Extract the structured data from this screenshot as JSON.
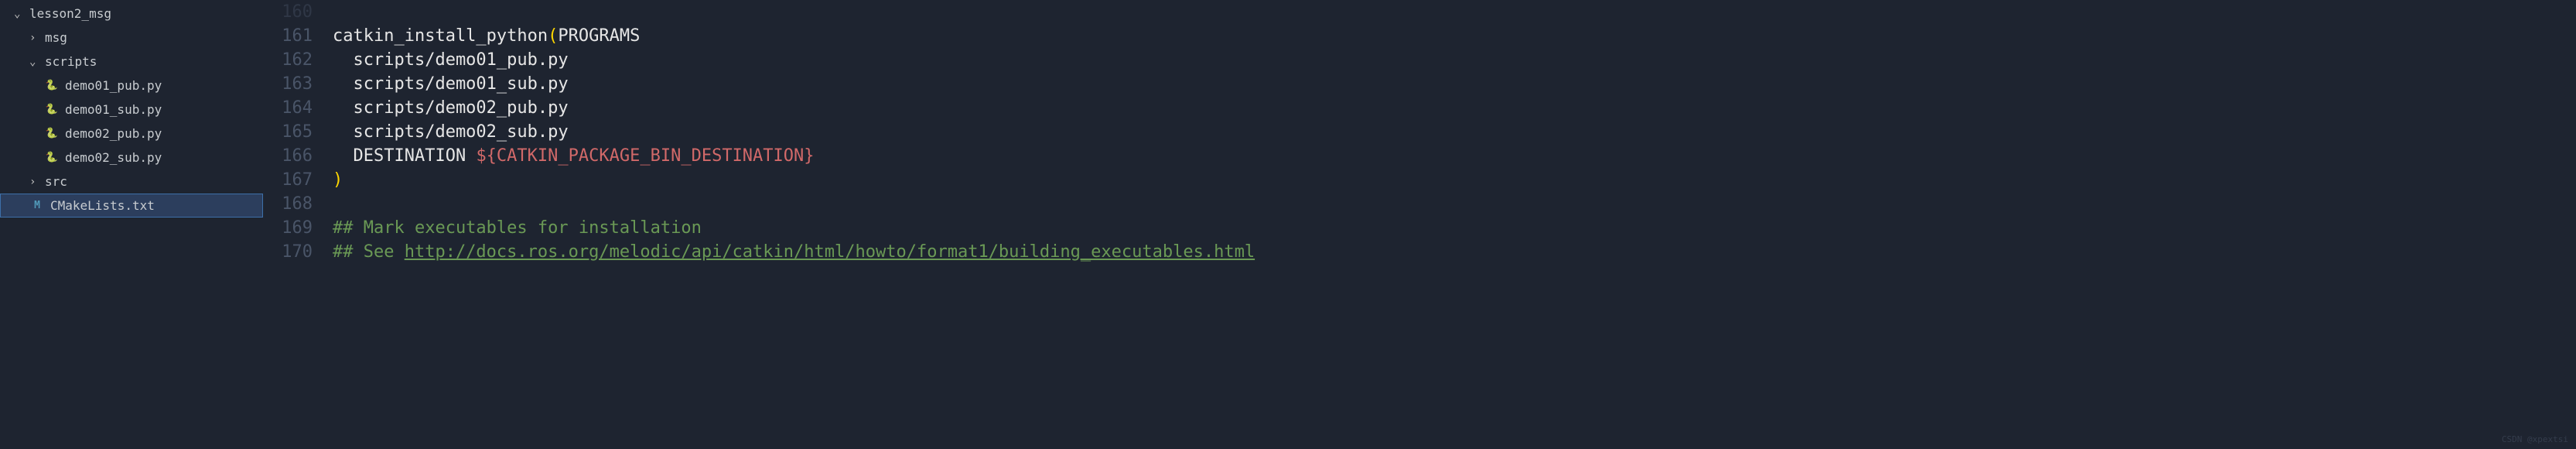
{
  "sidebar": {
    "root": "lesson2_msg",
    "items": [
      {
        "label": "msg",
        "type": "folder",
        "expanded": false,
        "indent": 1
      },
      {
        "label": "scripts",
        "type": "folder",
        "expanded": true,
        "indent": 1
      },
      {
        "label": "demo01_pub.py",
        "type": "python",
        "indent": 2
      },
      {
        "label": "demo01_sub.py",
        "type": "python",
        "indent": 2
      },
      {
        "label": "demo02_pub.py",
        "type": "python",
        "indent": 2
      },
      {
        "label": "demo02_sub.py",
        "type": "python",
        "indent": 2
      },
      {
        "label": "src",
        "type": "folder",
        "expanded": false,
        "indent": 1
      },
      {
        "label": "CMakeLists.txt",
        "type": "cmake",
        "indent": 1,
        "selected": true
      }
    ]
  },
  "editor": {
    "lines": [
      {
        "num": "161",
        "segments": [
          {
            "text": "catkin_install_python",
            "cls": "kw-white"
          },
          {
            "text": "(",
            "cls": "paren"
          },
          {
            "text": "PROGRAMS",
            "cls": "kw-white"
          }
        ]
      },
      {
        "num": "162",
        "segments": [
          {
            "text": "  scripts/demo01_pub.py",
            "cls": "kw-white"
          }
        ]
      },
      {
        "num": "163",
        "segments": [
          {
            "text": "  scripts/demo01_sub.py",
            "cls": "kw-white"
          }
        ]
      },
      {
        "num": "164",
        "segments": [
          {
            "text": "  scripts/demo02_pub.py",
            "cls": "kw-white"
          }
        ]
      },
      {
        "num": "165",
        "segments": [
          {
            "text": "  scripts/demo02_sub.py",
            "cls": "kw-white"
          }
        ]
      },
      {
        "num": "166",
        "segments": [
          {
            "text": "  DESTINATION ",
            "cls": "kw-white"
          },
          {
            "text": "${CATKIN_PACKAGE_BIN_DESTINATION}",
            "cls": "var-red"
          }
        ]
      },
      {
        "num": "167",
        "segments": [
          {
            "text": ")",
            "cls": "paren"
          }
        ]
      },
      {
        "num": "168",
        "segments": [
          {
            "text": "",
            "cls": ""
          }
        ]
      },
      {
        "num": "169",
        "segments": [
          {
            "text": "## Mark executables for installation",
            "cls": "comment"
          }
        ]
      },
      {
        "num": "170",
        "segments": [
          {
            "text": "## See ",
            "cls": "comment"
          },
          {
            "text": "http://docs.ros.org/melodic/api/catkin/html/howto/format1/building_executables.html",
            "cls": "comment-link"
          }
        ]
      }
    ],
    "partial_top_num": "160"
  },
  "watermark": "CSDN @xpextsi"
}
